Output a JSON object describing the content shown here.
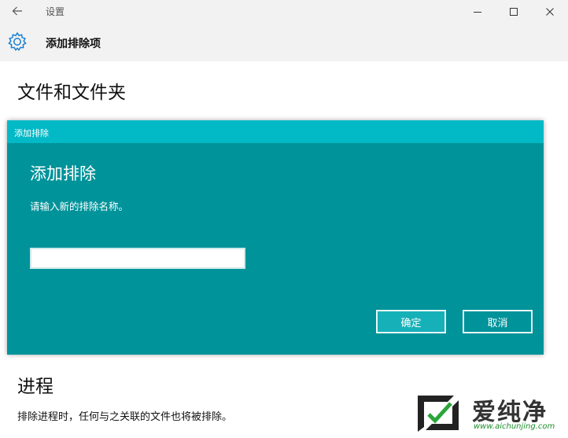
{
  "window": {
    "title": "设置"
  },
  "header": {
    "title": "添加排除项"
  },
  "section_files": {
    "title": "文件和文件夹"
  },
  "dialog": {
    "bar_title": "添加排除",
    "heading": "添加排除",
    "prompt": "请输入新的排除名称。",
    "input_value": "",
    "ok_label": "确定",
    "cancel_label": "取消",
    "colors": {
      "body": "#00939a",
      "titlebar": "#02b9c6"
    }
  },
  "section_process": {
    "title": "进程",
    "description": "排除进程时，任何与之关联的文件也将被排除。"
  },
  "watermark": {
    "brand": "爱纯净",
    "url": "www.aichunjing.com"
  },
  "icons": [
    "back-arrow-icon",
    "minimize-icon",
    "maximize-icon",
    "close-icon",
    "gear-icon"
  ]
}
